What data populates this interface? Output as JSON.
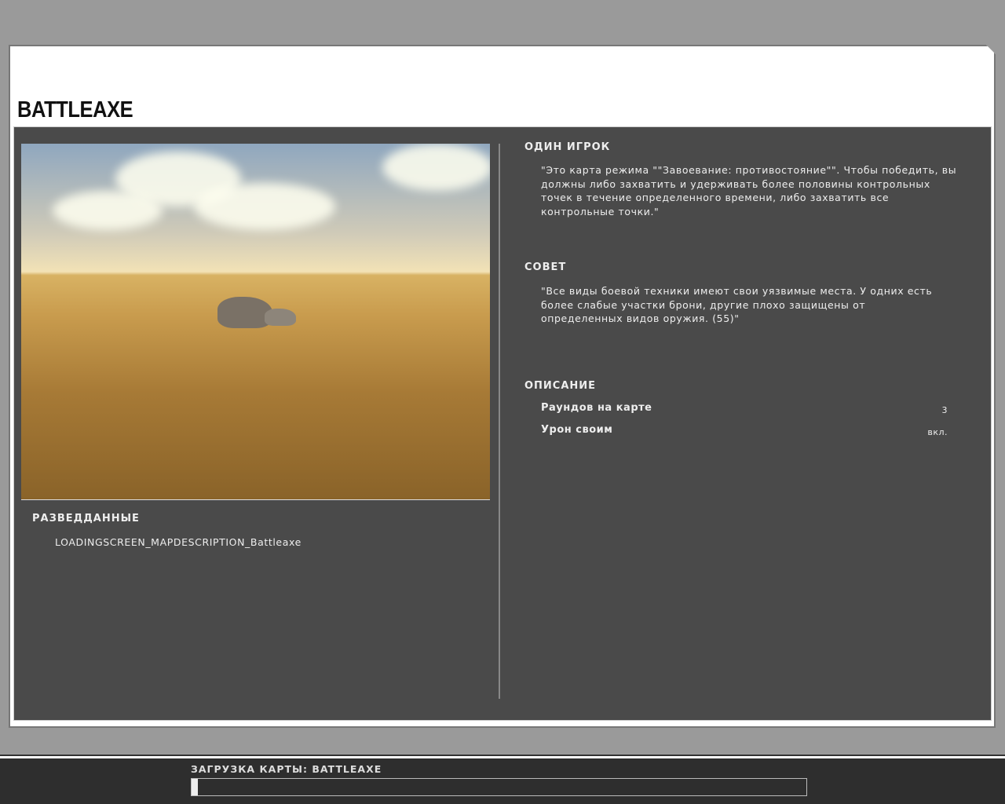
{
  "map_title": "BATTLEAXE",
  "intel": {
    "heading": "РАЗВЕДДАННЫЕ",
    "text": "LOADINGSCREEN_MAPDESCRIPTION_Battleaxe"
  },
  "single_player": {
    "heading": "ОДИН ИГРОК",
    "text": "\"Это карта режима \"\"Завоевание: противостояние\"\". Чтобы победить, вы должны либо захватить и удерживать более половины контрольных точек в течение определенного времени, либо захватить все контрольные точки.\""
  },
  "tip": {
    "heading": "СОВЕТ",
    "text": "\"Все виды боевой техники имеют свои уязвимые места. У одних есть более слабые участки брони, другие плохо защищены от определенных видов оружия. (55)\""
  },
  "description": {
    "heading": "ОПИСАНИЕ",
    "rows": [
      {
        "label": "Раундов на карте",
        "value": "3"
      },
      {
        "label": "Урон своим",
        "value": "вкл."
      }
    ]
  },
  "loading": {
    "label": "ЗАГРУЗКА КАРТЫ: BATTLEAXE",
    "progress_percent": 1
  }
}
